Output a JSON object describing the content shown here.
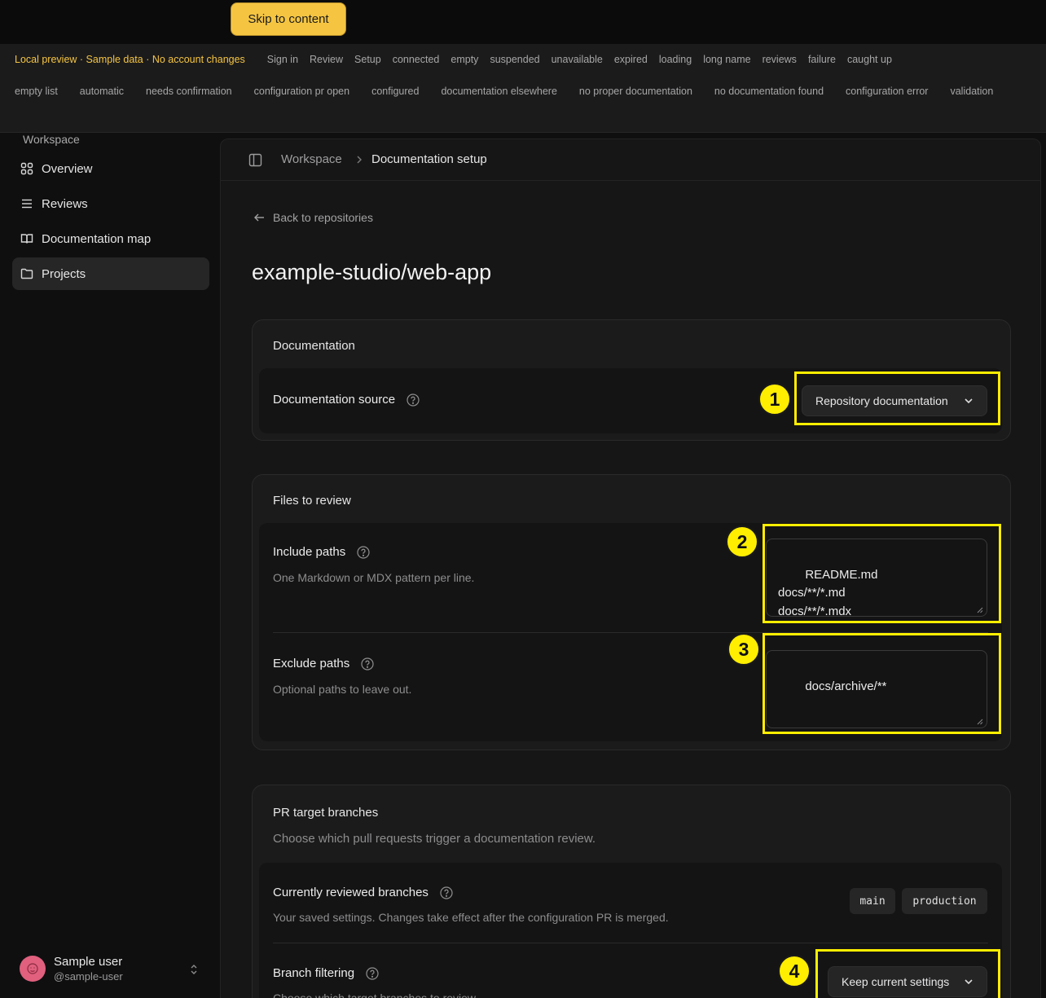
{
  "skip_link": "Skip to content",
  "preview_nav": {
    "banner": "Local preview · Sample data · No account changes",
    "row1": [
      "Sign in",
      "Review",
      "Setup",
      "connected",
      "empty",
      "suspended",
      "unavailable",
      "expired",
      "loading",
      "long name",
      "reviews",
      "failure",
      "caught up"
    ],
    "row2": [
      "empty list",
      "automatic",
      "needs confirmation",
      "configuration pr open",
      "configured",
      "documentation elsewhere",
      "no proper documentation",
      "no documentation found",
      "configuration error",
      "validation"
    ]
  },
  "sidebar": {
    "heading": "Workspace",
    "items": [
      {
        "label": "Overview",
        "icon": "grid-icon"
      },
      {
        "label": "Reviews",
        "icon": "list-icon"
      },
      {
        "label": "Documentation map",
        "icon": "book-icon"
      },
      {
        "label": "Projects",
        "icon": "folder-icon",
        "active": true
      }
    ],
    "user": {
      "name": "Sample user",
      "handle": "@sample-user"
    }
  },
  "breadcrumb": {
    "workspace": "Workspace",
    "current": "Documentation setup"
  },
  "back_link": "Back to repositories",
  "page_title": "example-studio/web-app",
  "documentation_card": {
    "title": "Documentation",
    "source_label": "Documentation source",
    "source_value": "Repository documentation"
  },
  "files_card": {
    "title": "Files to review",
    "include_label": "Include paths",
    "include_desc": "One Markdown or MDX pattern per line.",
    "include_value": "README.md\ndocs/**/*.md\ndocs/**/*.mdx",
    "exclude_label": "Exclude paths",
    "exclude_desc": "Optional paths to leave out.",
    "exclude_value": "docs/archive/**"
  },
  "branches_card": {
    "title": "PR target branches",
    "desc": "Choose which pull requests trigger a documentation review.",
    "current_label": "Currently reviewed branches",
    "current_desc": "Your saved settings. Changes take effect after the configuration PR is merged.",
    "branches": [
      "main",
      "production"
    ],
    "filter_label": "Branch filtering",
    "filter_desc": "Choose which target branches to review.",
    "filter_value": "Keep current settings"
  },
  "annotations": [
    "1",
    "2",
    "3",
    "4"
  ],
  "colors": {
    "accent": "#f5c542",
    "highlight": "#ffee00",
    "background": "#0f0f10",
    "card": "#1b1b1c"
  }
}
